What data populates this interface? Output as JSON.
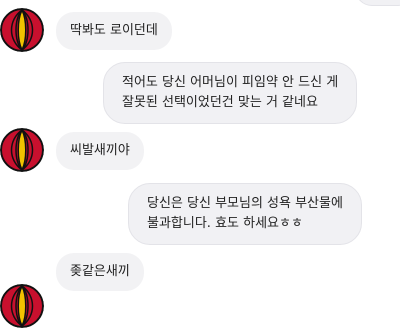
{
  "colors": {
    "avatar_red": "#c8102e",
    "avatar_yellow": "#f2c200",
    "avatar_outline": "#111111",
    "incoming_bubble": "#f2f2f4",
    "outgoing_bubble": "#f1f1f4"
  },
  "messages": [
    {
      "direction": "incoming",
      "avatar_icon": "beach-ball-avatar-icon",
      "text": "딱봐도 로이던데"
    },
    {
      "direction": "outgoing",
      "lines": [
        "적어도 당신 어머님이 피임약 안 드신 게",
        "잘못된 선택이었던건 맞는 거 같네요"
      ]
    },
    {
      "direction": "incoming",
      "avatar_icon": "beach-ball-avatar-icon",
      "text": "씨발새끼야"
    },
    {
      "direction": "outgoing",
      "lines": [
        "당신은 당신 부모님의 성욕 부산물에",
        "불과합니다. 효도 하세요ㅎㅎ"
      ]
    },
    {
      "direction": "incoming",
      "avatar_icon": "beach-ball-avatar-icon",
      "text": "좆같은새끼"
    }
  ]
}
